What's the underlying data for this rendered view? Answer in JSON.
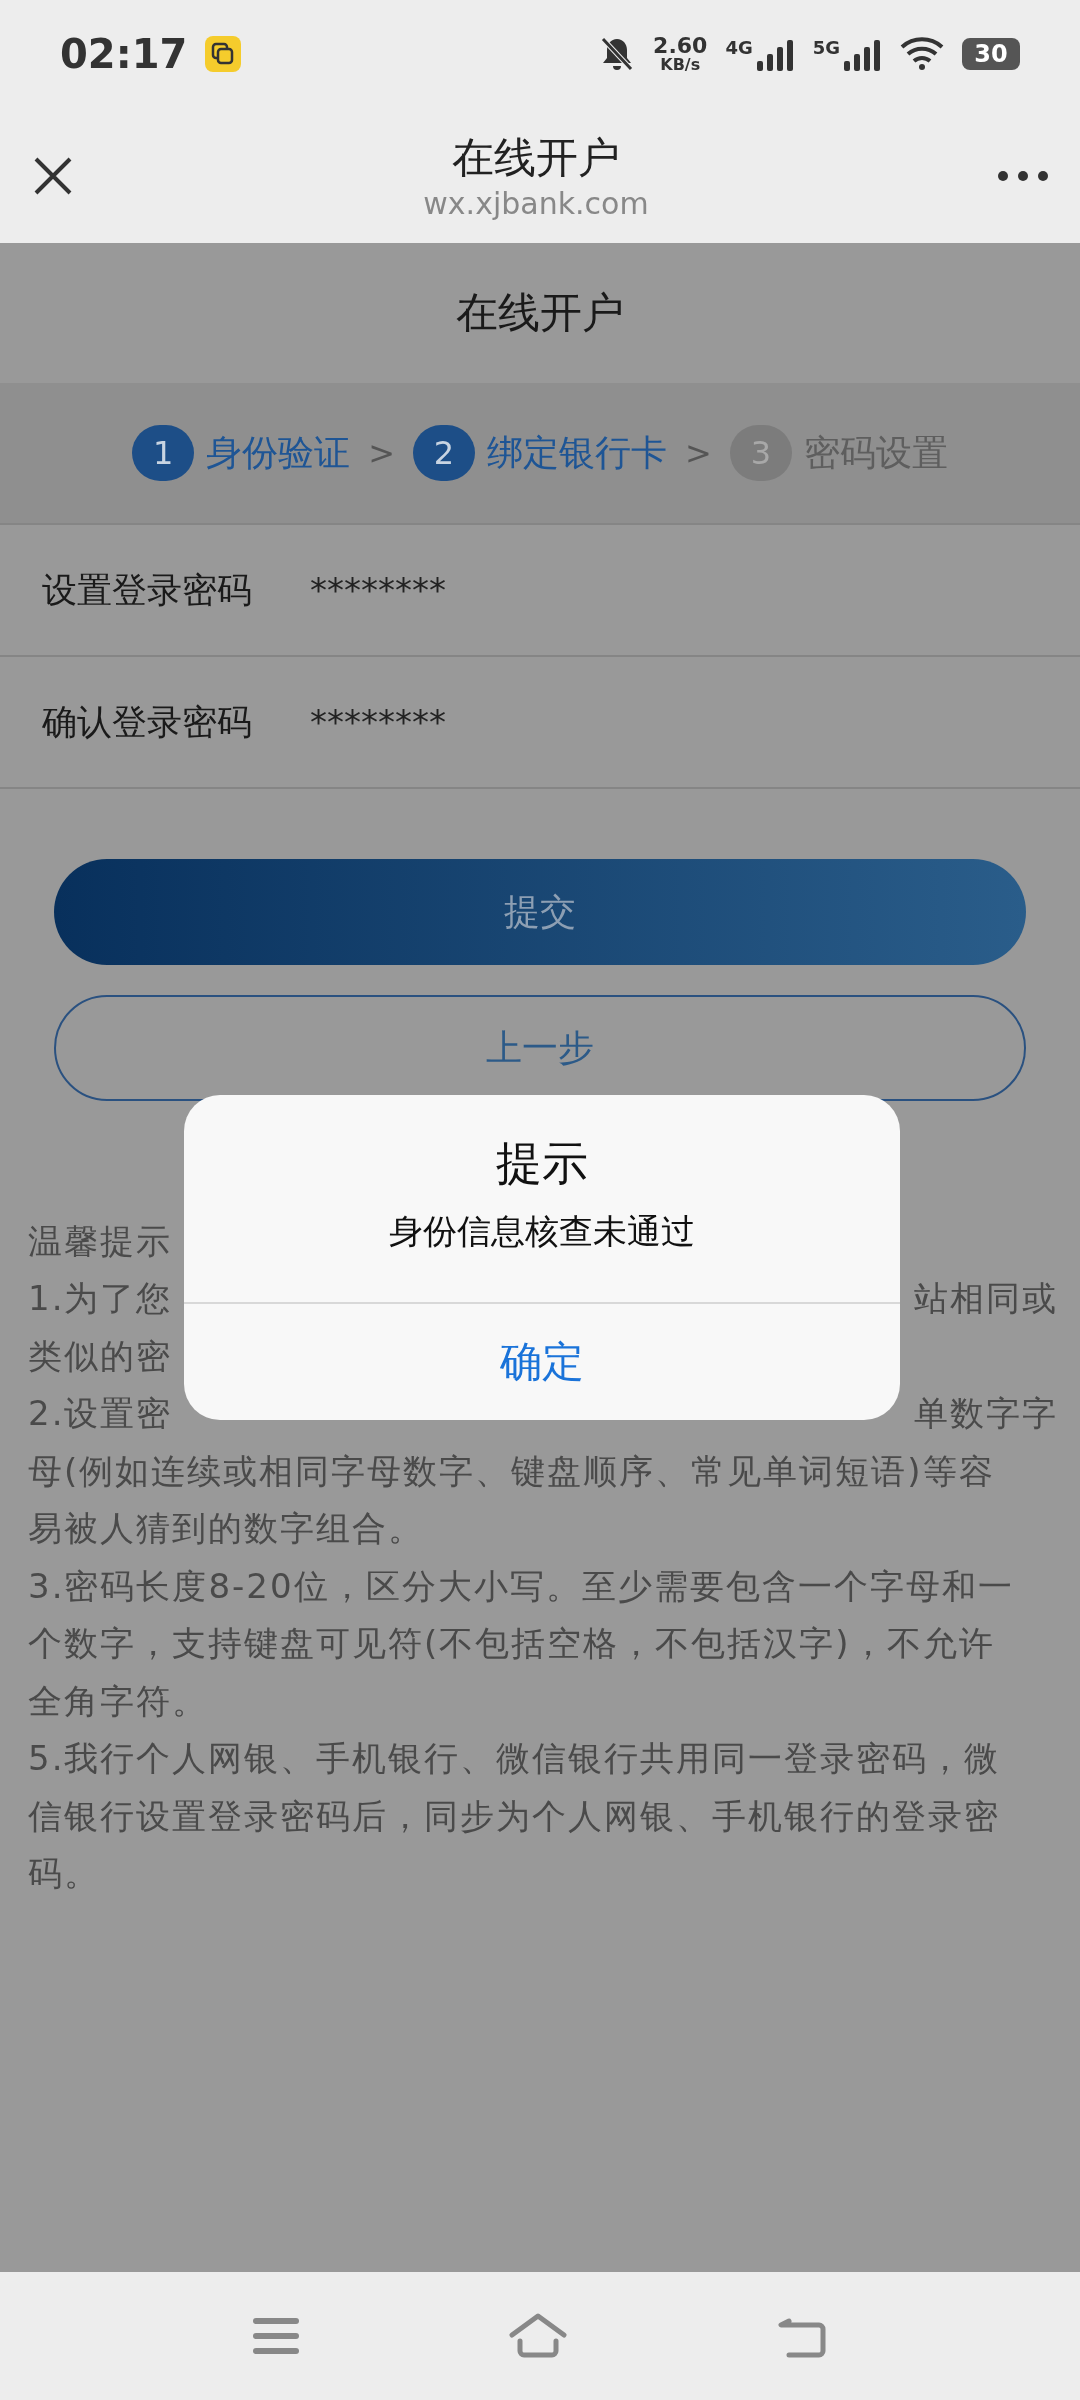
{
  "status_bar": {
    "time": "02:17",
    "speed_value": "2.60",
    "speed_unit": "KB/s",
    "network_1": "4G",
    "network_2": "5G",
    "battery": "30"
  },
  "browser_bar": {
    "title": "在线开户",
    "url": "wx.xjbank.com"
  },
  "page_title": "在线开户",
  "steps": [
    {
      "number": "1",
      "label": "身份验证",
      "completed": true,
      "separator": ">"
    },
    {
      "number": "2",
      "label": "绑定银行卡",
      "completed": true,
      "separator": ">"
    },
    {
      "number": "3",
      "label": "密码设置",
      "completed": false
    }
  ],
  "fields": [
    {
      "label": "设置登录密码",
      "value": "********"
    },
    {
      "label": "确认登录密码",
      "value": "********"
    }
  ],
  "buttons": [
    {
      "kind": "primary",
      "label": "提交"
    },
    {
      "kind": "outline",
      "label": "上一步"
    }
  ],
  "tips": [
    {
      "left": "温馨提示"
    },
    {
      "left": "1.为了您",
      "right": "站相同或"
    },
    {
      "left": "类似的密"
    },
    {
      "left": "2.设置密",
      "right": "单数字字"
    },
    {
      "left": "母(例如连续或相同字母数字、键盘顺序、常见单词短语)等容"
    },
    {
      "left": "易被人猜到的数字组合。"
    },
    {
      "left": "3.密码长度8-20位，区分大小写。至少需要包含一个字母和一"
    },
    {
      "left": "个数字，支持键盘可见符(不包括空格，不包括汉字)，不允许"
    },
    {
      "left": "全角字符。"
    },
    {
      "left": "5.我行个人网银、手机银行、微信银行共用同一登录密码，微"
    },
    {
      "left": "信银行设置登录密码后，同步为个人网银、手机银行的登录密"
    },
    {
      "left": "码。"
    }
  ],
  "dialog": {
    "title": "提示",
    "message": "身份信息核查未通过",
    "confirm": "确定"
  }
}
